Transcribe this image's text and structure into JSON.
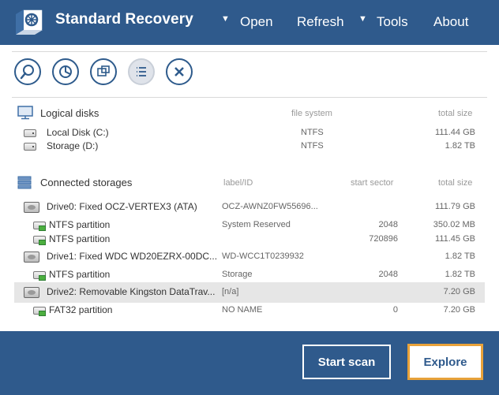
{
  "header": {
    "app_title": "Standard Recovery",
    "menu": [
      {
        "label": "Open",
        "has_arrow": true
      },
      {
        "label": "Refresh",
        "has_arrow": false
      },
      {
        "label": "Tools",
        "has_arrow": true
      },
      {
        "label": "About",
        "has_arrow": false
      }
    ]
  },
  "toolbar": {
    "buttons": [
      "search-icon",
      "pie-chart-icon",
      "folders-icon",
      "list-icon",
      "close-icon"
    ],
    "active": "list-icon"
  },
  "logical": {
    "title": "Logical disks",
    "cols": {
      "fs": "file system",
      "size": "total size"
    },
    "rows": [
      {
        "name": "Local Disk (C:)",
        "fs": "NTFS",
        "size": "111.44 GB"
      },
      {
        "name": "Storage (D:)",
        "fs": "NTFS",
        "size": "1.82 TB"
      }
    ]
  },
  "connected": {
    "title": "Connected storages",
    "cols": {
      "label": "label/ID",
      "sector": "start sector",
      "size": "total size"
    },
    "rows": [
      {
        "name": "Drive0: Fixed OCZ-VERTEX3 (ATA)",
        "label": "OCZ-AWNZ0FW55696...",
        "sector": "",
        "size": "111.79 GB",
        "kind": "drive",
        "selected": false
      },
      {
        "name": "NTFS partition",
        "label": "System Reserved",
        "sector": "2048",
        "size": "350.02 MB",
        "kind": "part",
        "selected": false
      },
      {
        "name": "NTFS partition",
        "label": "",
        "sector": "720896",
        "size": "111.45 GB",
        "kind": "part",
        "selected": false
      },
      {
        "name": "Drive1: Fixed WDC WD20EZRX-00DC...",
        "label": "WD-WCC1T0239932",
        "sector": "",
        "size": "1.82 TB",
        "kind": "drive",
        "selected": false
      },
      {
        "name": "NTFS partition",
        "label": "Storage",
        "sector": "2048",
        "size": "1.82 TB",
        "kind": "part",
        "selected": false
      },
      {
        "name": "Drive2: Removable Kingston DataTrav...",
        "label": "[n/a]",
        "sector": "",
        "size": "7.20 GB",
        "kind": "drive",
        "selected": true
      },
      {
        "name": "FAT32 partition",
        "label": "NO NAME",
        "sector": "0",
        "size": "7.20 GB",
        "kind": "part",
        "selected": false
      }
    ]
  },
  "footer": {
    "start_scan": "Start scan",
    "explore": "Explore"
  },
  "colors": {
    "brand": "#2f5a8c",
    "accent": "#e8a23a",
    "selected_row": "#e6e6e6"
  }
}
